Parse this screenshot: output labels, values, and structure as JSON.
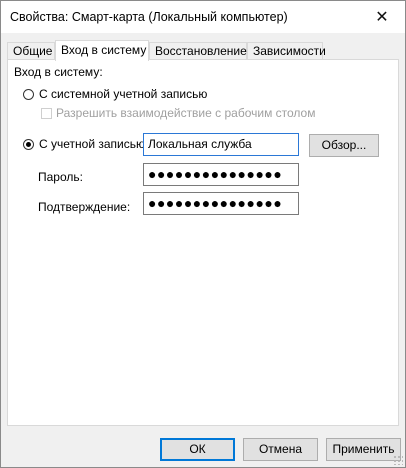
{
  "window": {
    "title": "Свойства: Смарт-карта (Локальный компьютер)",
    "close_glyph": "✕"
  },
  "tabs": [
    {
      "label": "Общие",
      "active": false
    },
    {
      "label": "Вход в систему",
      "active": true
    },
    {
      "label": "Восстановление",
      "active": false
    },
    {
      "label": "Зависимости",
      "active": false
    }
  ],
  "logon": {
    "group_label": "Вход в систему:",
    "system_account": {
      "label": "С системной учетной записью",
      "selected": false
    },
    "allow_desktop": {
      "label": "Разрешить взаимодействие с рабочим столом",
      "checked": false,
      "enabled": false
    },
    "this_account": {
      "label": "С учетной записью:",
      "selected": true,
      "value": "Локальная служба"
    },
    "browse_label": "Обзор...",
    "password": {
      "label": "Пароль:",
      "value": "●●●●●●●●●●●●●●●"
    },
    "confirm": {
      "label": "Подтверждение:",
      "value": "●●●●●●●●●●●●●●●"
    }
  },
  "footer": {
    "ok_label": "ОК",
    "cancel_label": "Отмена",
    "apply_label": "Применить"
  },
  "colors": {
    "focus_border": "#2b78d6",
    "default_button_border": "#0078d7",
    "dialog_bg": "#f0f0f0"
  }
}
